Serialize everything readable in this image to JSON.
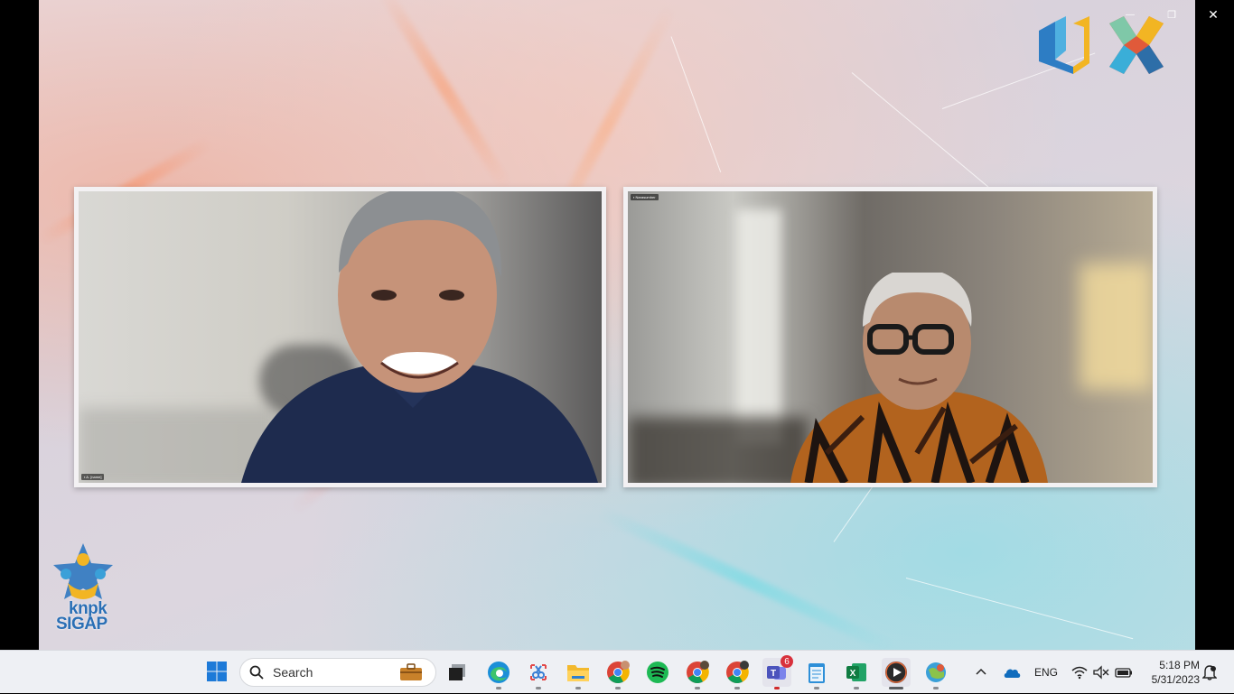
{
  "window": {
    "minimize_icon": "minimize-icon",
    "restore_icon": "restore-icon",
    "close_icon": "close-icon",
    "minimize_glyph": "—",
    "restore_glyph": "❐",
    "close_glyph": "✕"
  },
  "meeting": {
    "participants": [
      {
        "name_tag": "▪ A. [name]"
      },
      {
        "name_tag": "▪ Narasumber"
      }
    ]
  },
  "brand": {
    "logo_left_line1": "knpk",
    "logo_left_line2": "SIGAP"
  },
  "taskbar": {
    "search_label": "Search",
    "apps": [
      {
        "name": "task-view"
      },
      {
        "name": "edge"
      },
      {
        "name": "snipping-tool"
      },
      {
        "name": "file-explorer"
      },
      {
        "name": "chrome-1"
      },
      {
        "name": "spotify"
      },
      {
        "name": "chrome-2"
      },
      {
        "name": "chrome-3"
      },
      {
        "name": "teams",
        "badge": "6"
      },
      {
        "name": "notepad"
      },
      {
        "name": "excel"
      },
      {
        "name": "media-player"
      },
      {
        "name": "maps"
      }
    ],
    "tray": {
      "language": "ENG",
      "time": "5:18 PM",
      "date": "5/31/2023"
    }
  },
  "colors": {
    "taskbar_bg": "#eef0f4",
    "accent_blue": "#0067c0"
  }
}
